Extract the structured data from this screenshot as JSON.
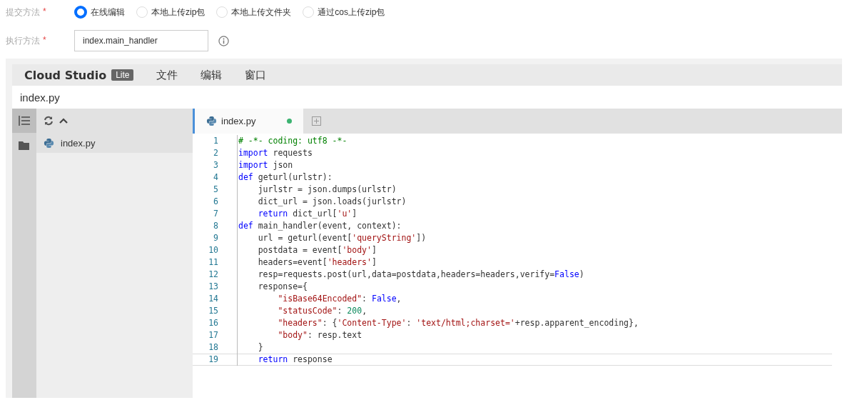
{
  "form": {
    "submit_method": {
      "label": "提交方法",
      "required": "*",
      "options": [
        {
          "label": "在线编辑",
          "selected": true
        },
        {
          "label": "本地上传zip包",
          "selected": false
        },
        {
          "label": "本地上传文件夹",
          "selected": false
        },
        {
          "label": "通过cos上传zip包",
          "selected": false
        }
      ]
    },
    "handler": {
      "label": "执行方法",
      "required": "*",
      "value": "index.main_handler"
    }
  },
  "ide": {
    "brand": "Cloud Studio",
    "badge": "Lite",
    "menu": [
      "文件",
      "编辑",
      "窗口"
    ],
    "path": "index.py",
    "tree": [
      {
        "name": "index.py",
        "selected": true
      }
    ],
    "tabs": [
      {
        "label": "index.py",
        "selected": true,
        "modified": true
      }
    ],
    "lines": [
      {
        "number": "1",
        "current": false,
        "tokens": [
          {
            "kind": "comment",
            "text": "# -*- coding: utf8 -*-"
          }
        ]
      },
      {
        "number": "2",
        "current": false,
        "tokens": [
          {
            "kind": "keyword",
            "text": "import"
          },
          {
            "kind": "plain",
            "text": " requests"
          }
        ]
      },
      {
        "number": "3",
        "current": false,
        "tokens": [
          {
            "kind": "keyword",
            "text": "import"
          },
          {
            "kind": "plain",
            "text": " json"
          }
        ]
      },
      {
        "number": "4",
        "current": false,
        "tokens": [
          {
            "kind": "keyword",
            "text": "def"
          },
          {
            "kind": "plain",
            "text": " geturl(urlstr):"
          }
        ]
      },
      {
        "number": "5",
        "current": false,
        "tokens": [
          {
            "kind": "plain",
            "text": "    jurlstr = json.dumps(urlstr)"
          }
        ]
      },
      {
        "number": "6",
        "current": false,
        "tokens": [
          {
            "kind": "plain",
            "text": "    dict_url = json.loads(jurlstr)"
          }
        ]
      },
      {
        "number": "7",
        "current": false,
        "tokens": [
          {
            "kind": "keyword",
            "text": "    return"
          },
          {
            "kind": "plain",
            "text": " dict_url["
          },
          {
            "kind": "string",
            "text": "'u'"
          },
          {
            "kind": "plain",
            "text": "]"
          }
        ]
      },
      {
        "number": "8",
        "current": false,
        "tokens": [
          {
            "kind": "keyword",
            "text": "def"
          },
          {
            "kind": "plain",
            "text": " main_handler(event, context):"
          }
        ]
      },
      {
        "number": "9",
        "current": false,
        "tokens": [
          {
            "kind": "plain",
            "text": "    url = geturl(event["
          },
          {
            "kind": "string",
            "text": "'queryString'"
          },
          {
            "kind": "plain",
            "text": "])"
          }
        ]
      },
      {
        "number": "10",
        "current": false,
        "tokens": [
          {
            "kind": "plain",
            "text": "    postdata = event["
          },
          {
            "kind": "string",
            "text": "'body'"
          },
          {
            "kind": "plain",
            "text": "]"
          }
        ]
      },
      {
        "number": "11",
        "current": false,
        "tokens": [
          {
            "kind": "plain",
            "text": "    headers=event["
          },
          {
            "kind": "string",
            "text": "'headers'"
          },
          {
            "kind": "plain",
            "text": "]"
          }
        ]
      },
      {
        "number": "12",
        "current": false,
        "tokens": [
          {
            "kind": "plain",
            "text": "    resp=requests.post(url,data=postdata,headers=headers,verify="
          },
          {
            "kind": "keyword",
            "text": "False"
          },
          {
            "kind": "plain",
            "text": ")"
          }
        ]
      },
      {
        "number": "13",
        "current": false,
        "tokens": [
          {
            "kind": "plain",
            "text": "    response={"
          }
        ]
      },
      {
        "number": "14",
        "current": false,
        "tokens": [
          {
            "kind": "string",
            "text": "        \"isBase64Encoded\""
          },
          {
            "kind": "plain",
            "text": ": "
          },
          {
            "kind": "keyword",
            "text": "False"
          },
          {
            "kind": "plain",
            "text": ","
          }
        ]
      },
      {
        "number": "15",
        "current": false,
        "tokens": [
          {
            "kind": "string",
            "text": "        \"statusCode\""
          },
          {
            "kind": "plain",
            "text": ": "
          },
          {
            "kind": "number",
            "text": "200"
          },
          {
            "kind": "plain",
            "text": ","
          }
        ]
      },
      {
        "number": "16",
        "current": false,
        "tokens": [
          {
            "kind": "string",
            "text": "        \"headers\""
          },
          {
            "kind": "plain",
            "text": ": {"
          },
          {
            "kind": "string",
            "text": "'Content-Type'"
          },
          {
            "kind": "plain",
            "text": ": "
          },
          {
            "kind": "string",
            "text": "'text/html;charset='"
          },
          {
            "kind": "plain",
            "text": "+resp.apparent_encoding},"
          }
        ]
      },
      {
        "number": "17",
        "current": false,
        "tokens": [
          {
            "kind": "string",
            "text": "        \"body\""
          },
          {
            "kind": "plain",
            "text": ": resp.text"
          }
        ]
      },
      {
        "number": "18",
        "current": false,
        "tokens": [
          {
            "kind": "plain",
            "text": "    }"
          }
        ]
      },
      {
        "number": "19",
        "current": true,
        "tokens": [
          {
            "kind": "keyword",
            "text": "    return"
          },
          {
            "kind": "plain",
            "text": " response"
          }
        ]
      }
    ]
  }
}
